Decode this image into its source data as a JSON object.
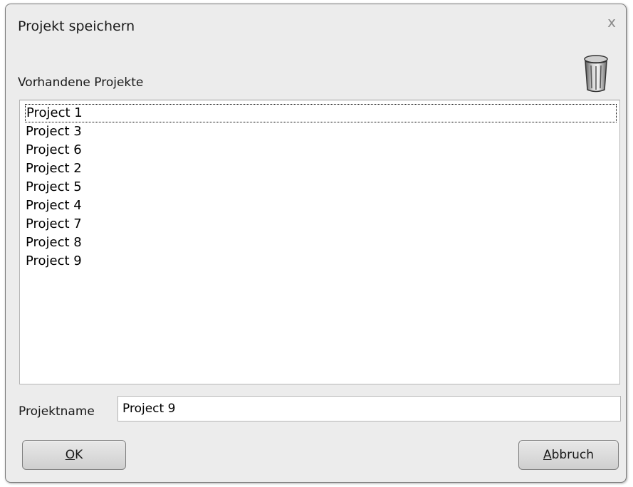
{
  "dialog": {
    "title": "Projekt speichern",
    "close_glyph": "x",
    "close_icon": "close-icon",
    "delete_icon": "trash-icon"
  },
  "projects": {
    "label": "Vorhandene Projekte",
    "items": [
      "Project 1",
      "Project 3",
      "Project 6",
      "Project 2",
      "Project 5",
      "Project 4",
      "Project 7",
      "Project 8",
      "Project 9"
    ],
    "focused_index": 0
  },
  "name_field": {
    "label": "Projektname",
    "value": "Project 9"
  },
  "buttons": {
    "ok": {
      "mnemonic": "O",
      "rest": "K"
    },
    "cancel": {
      "mnemonic": "A",
      "rest": "bbruch"
    }
  }
}
